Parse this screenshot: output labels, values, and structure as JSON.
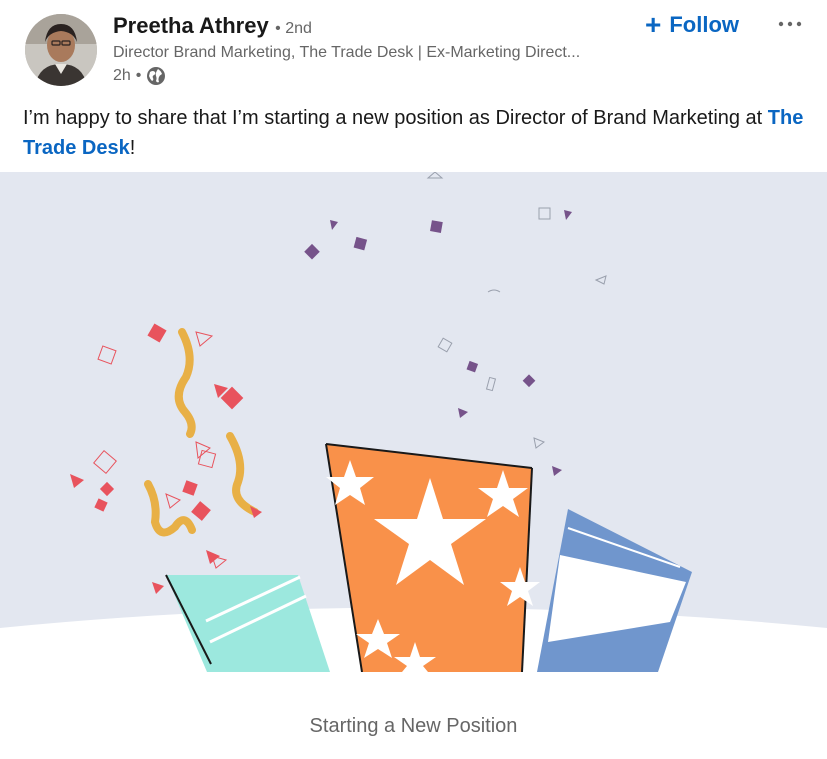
{
  "author": {
    "name": "Preetha Athrey",
    "degree": "• 2nd",
    "headline": "Director Brand Marketing, The Trade Desk | Ex-Marketing Direct...",
    "time": "2h",
    "time_separator": "•",
    "visibility_icon": "globe-icon",
    "avatar_icon": "profile-photo"
  },
  "actions": {
    "follow_label": "Follow",
    "follow_icon": "plus-icon",
    "more_icon": "ellipsis-icon"
  },
  "post": {
    "text_before": "I’m happy to share that I’m starting a new position as Director of Brand Marketing at ",
    "mention": "The Trade Desk",
    "text_after": "!"
  },
  "media": {
    "illustration": "celebration-confetti-cups",
    "caption": "Starting a New Position"
  },
  "colors": {
    "brand_blue": "#0a66c2",
    "secondary_text": "#666666",
    "media_background": "#e3e7f0",
    "orange": "#f9914a",
    "teal": "#9ce8de",
    "blue_stripe": "#7096cd",
    "red": "#e8535d",
    "purple": "#76538a",
    "gold": "#e8b046"
  }
}
